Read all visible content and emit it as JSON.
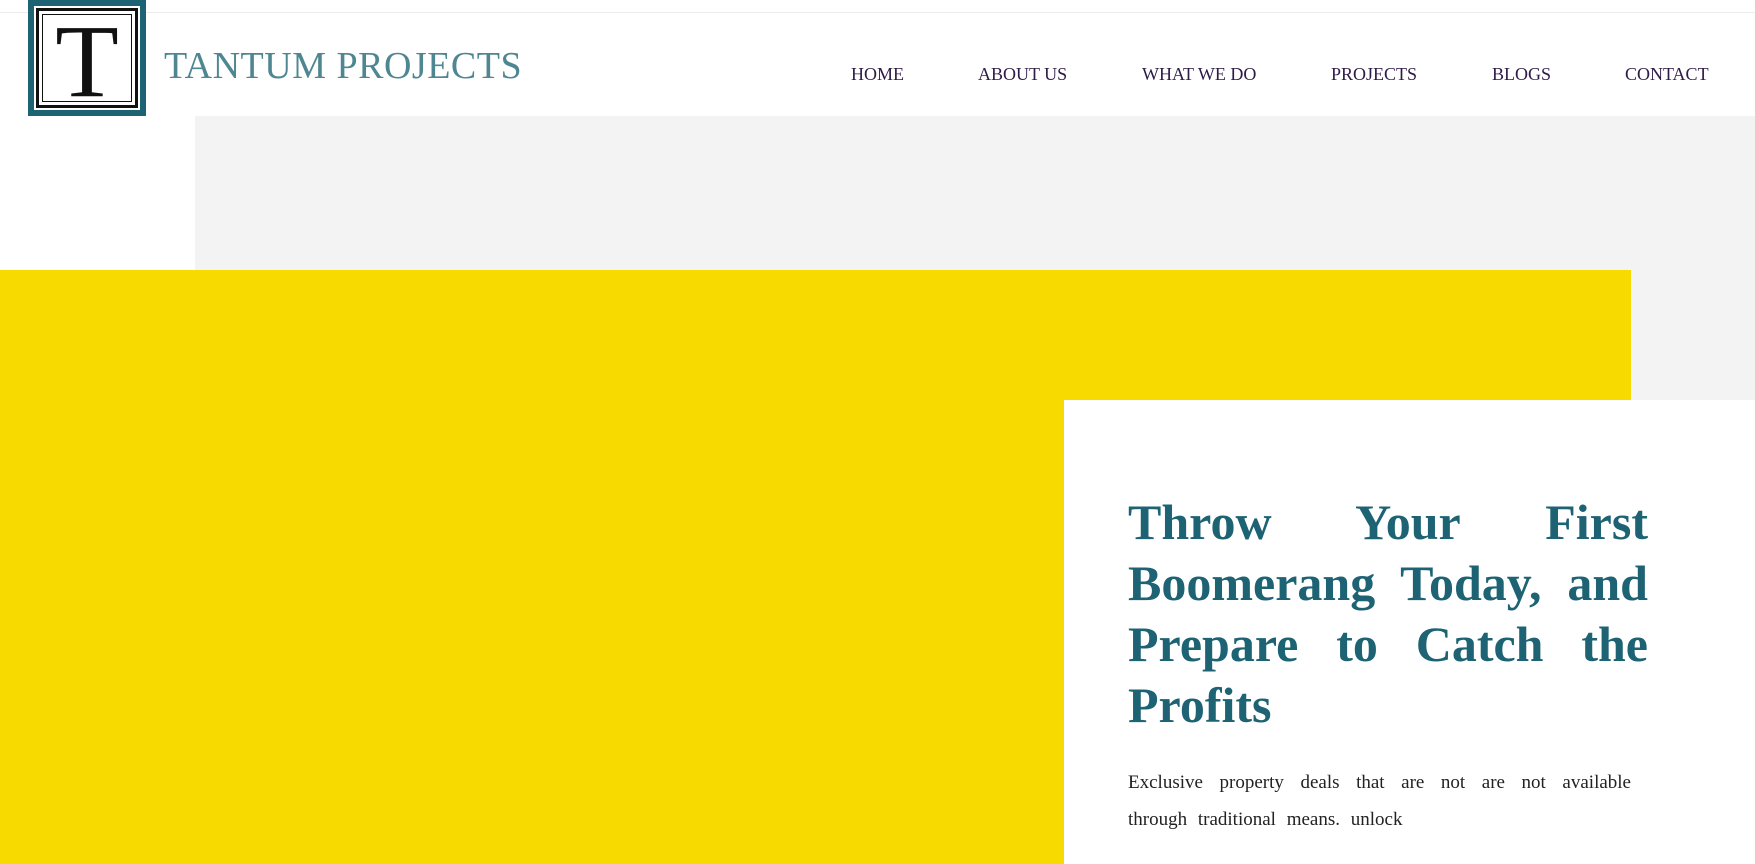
{
  "header": {
    "logo_letter": "T",
    "brand_name": "TANTUM PROJECTS"
  },
  "nav": {
    "items": [
      {
        "label": "HOME"
      },
      {
        "label": "ABOUT US"
      },
      {
        "label": "WHAT WE DO"
      },
      {
        "label": "PROJECTS"
      },
      {
        "label": "BLOGS"
      },
      {
        "label": "CONTACT"
      }
    ]
  },
  "hero": {
    "title": "Throw Your First Boomerang Today, and Prepare to Catch the Profits",
    "text": "Exclusive property deals that are not are not available through traditional means. unlock"
  },
  "colors": {
    "brand_teal": "#1d6374",
    "brand_text": "#4e8691",
    "nav_text": "#2e1a47",
    "hero_yellow": "#f6da00",
    "panel_gray": "#f3f3f3"
  },
  "icons": {
    "logo": "letter-t-logo-icon"
  }
}
